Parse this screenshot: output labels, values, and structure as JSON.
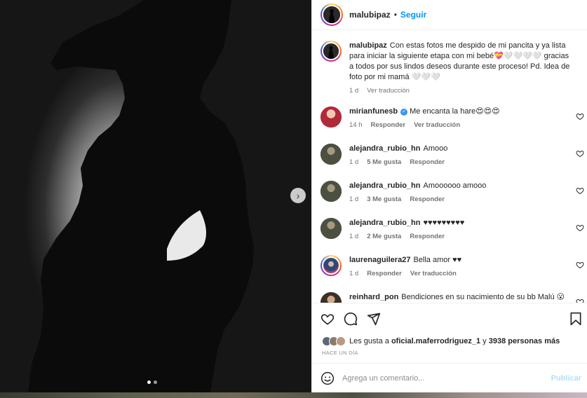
{
  "post": {
    "author": "malubipaz",
    "follow_label": "Seguir",
    "separator": "•",
    "carousel_next": "›"
  },
  "caption": {
    "user": "malubipaz",
    "text": "Con estas fotos me despido de mi pancita y ya lista para iniciar la siguiente etapa con mi bebé💝🤍🤍🤍🤍 gracias a todos por sus lindos deseos durante este proceso! Pd. Idea de foto por mi mamá 🤍🤍🤍",
    "time": "1 d",
    "translate": "Ver traducción"
  },
  "comments": [
    {
      "user": "mirianfunesb",
      "verified": true,
      "text": "Me encanta la hare😍😍😍",
      "time": "14 h",
      "likes": "",
      "reply": "Responder",
      "translate": "Ver traducción"
    },
    {
      "user": "alejandra_rubio_hn",
      "verified": false,
      "text": "Amooo",
      "time": "1 d",
      "likes": "5 Me gusta",
      "reply": "Responder",
      "translate": ""
    },
    {
      "user": "alejandra_rubio_hn",
      "verified": false,
      "text": "Amoooooo amooo",
      "time": "1 d",
      "likes": "3 Me gusta",
      "reply": "Responder",
      "translate": ""
    },
    {
      "user": "alejandra_rubio_hn",
      "verified": false,
      "text": "♥♥♥♥♥♥♥♥♥",
      "time": "1 d",
      "likes": "2 Me gusta",
      "reply": "Responder",
      "translate": ""
    },
    {
      "user": "laurenaguilera27",
      "verified": false,
      "text": "Bella amor ♥♥",
      "time": "1 d",
      "likes": "",
      "reply": "Responder",
      "translate": "Ver traducción"
    },
    {
      "user": "reinhard_pon",
      "verified": false,
      "text": "Bendiciones en su nacimiento de su bb Malú 😮",
      "time": "",
      "likes": "",
      "reply": "",
      "translate": ""
    }
  ],
  "likes": {
    "prefix": "Les gusta a",
    "first_user": "oficial.maferrodriguez_1",
    "middle": "y",
    "count": "3938 personas más"
  },
  "date": "HACE UN DÍA",
  "add_comment": {
    "placeholder": "Agrega un comentario...",
    "publish": "Publicar"
  },
  "icons": {
    "like": "heart-icon",
    "comment": "comment-icon",
    "share": "share-icon",
    "save": "bookmark-icon",
    "emoji": "emoji-icon"
  },
  "colors": {
    "link_blue": "#0095f6",
    "publish_disabled": "#b2dffc",
    "muted": "#737373"
  }
}
